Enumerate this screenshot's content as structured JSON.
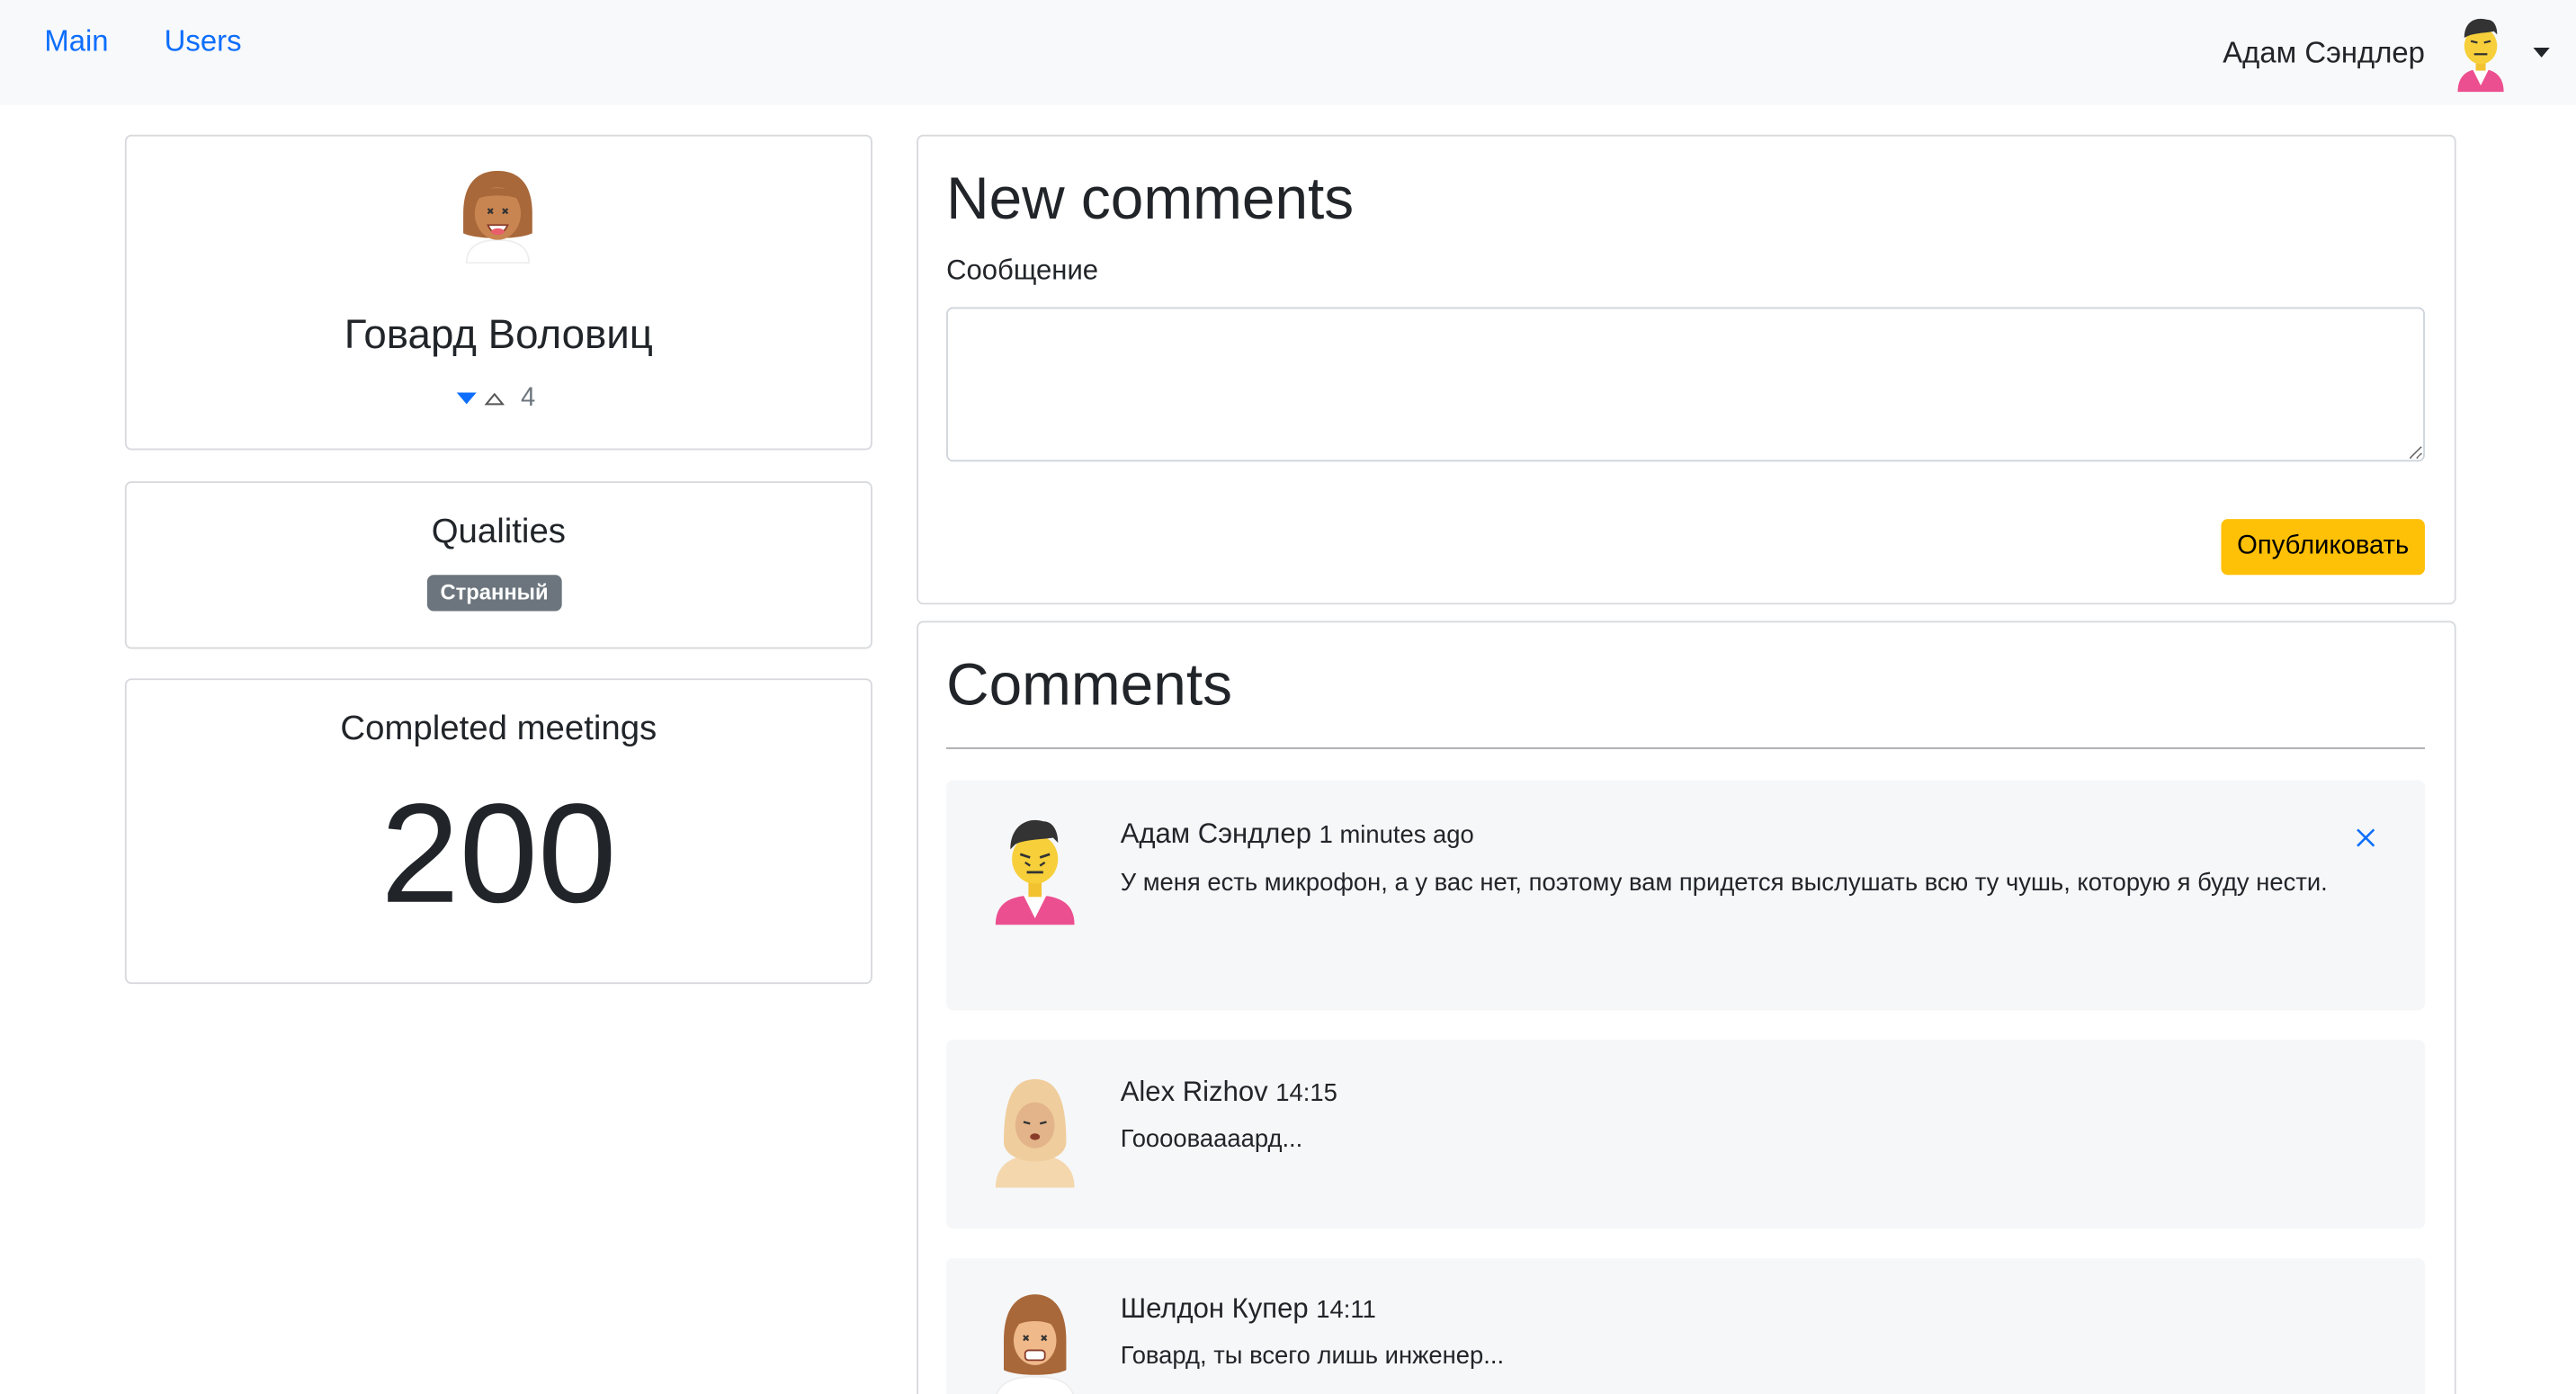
{
  "nav": {
    "main": "Main",
    "users": "Users",
    "current_user": "Адам Сэндлер"
  },
  "profile": {
    "name": "Говард Воловиц",
    "rate": "4"
  },
  "qualities": {
    "title": "Qualities",
    "items": [
      "Странный"
    ]
  },
  "meetings": {
    "title": "Completed meetings",
    "value": "200"
  },
  "new_comment": {
    "title": "New comments",
    "label": "Сообщение",
    "value": "",
    "submit": "Опубликовать"
  },
  "comments": {
    "title": "Comments",
    "items": [
      {
        "author": "Адам Сэндлер",
        "time": "1 minutes ago",
        "text": "У меня есть микрофон, а у вас нет, поэтому вам придется выслушать всю ту чушь, которую я буду нести.",
        "avatar": "avatar-man-black-hair-icon"
      },
      {
        "author": "Alex Rizhov",
        "time": "14:15",
        "text": "Гооооваааард...",
        "avatar": "avatar-woman-hijab-icon"
      },
      {
        "author": "Шелдон Купер",
        "time": "14:11",
        "text": "Говард, ты всего лишь инженер...",
        "avatar": "avatar-woman-brown-hair-icon"
      }
    ]
  },
  "colors": {
    "link": "#0d6efd",
    "accent_button": "#ffc107",
    "badge": "#6c757d",
    "navbar_bg": "#f8f9fa",
    "comment_bg": "#f6f7f9"
  }
}
